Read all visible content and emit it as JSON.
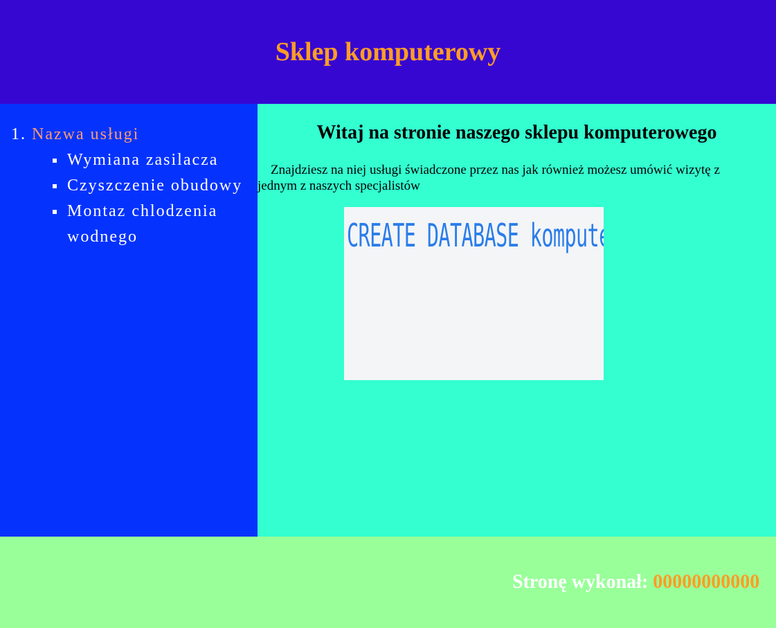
{
  "header": {
    "title": "Sklep komputerowy"
  },
  "sidebar": {
    "list_number": "1.",
    "section_title": "Nazwa usługi",
    "items": [
      {
        "label": "Wymiana zasilacza"
      },
      {
        "label": "Czyszczenie obudowy"
      },
      {
        "label": "Montaz chlodzenia wodnego"
      }
    ]
  },
  "main": {
    "heading": "Witaj na stronie naszego sklepu komputerowego",
    "paragraph": "Znajdziesz na niej usługi świadczone przez nas jak również możesz umówić wizytę z jednym z naszych specjalistów",
    "image": {
      "code_text": "CREATE DATABASE komputery",
      "code_semicolon": ";"
    }
  },
  "footer": {
    "credit_label": "Stronę wykonał:",
    "author": "00000000000"
  },
  "colors": {
    "header_bg": "#3707d2",
    "title": "#ff9d24",
    "sidebar_bg": "#0533fd",
    "sidebar_title": "#ff9c6e",
    "main_bg": "#33ffd0",
    "footer_bg": "#99ff99",
    "footer_author": "#ff9d24"
  }
}
